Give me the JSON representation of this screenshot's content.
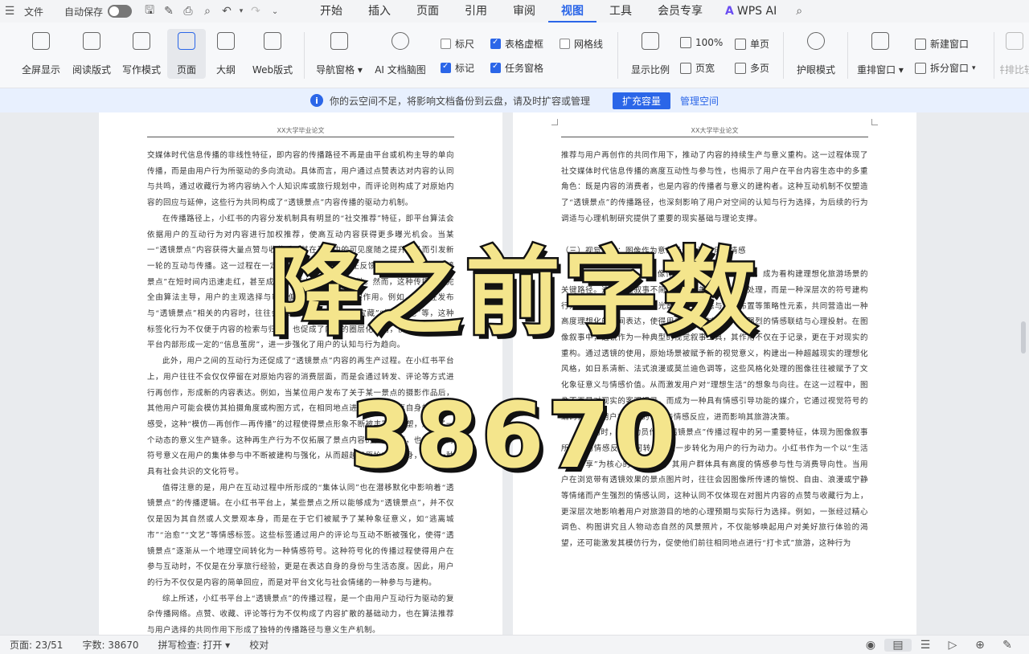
{
  "menubar": {
    "file_label": "文件",
    "autosave_label": "自动保存",
    "tabs": [
      "开始",
      "插入",
      "页面",
      "引用",
      "审阅",
      "视图",
      "工具",
      "会员专享"
    ],
    "active_tab": "视图",
    "wps_ai_label": "WPS AI"
  },
  "ribbon": {
    "fullscreen": "全屏显示",
    "reading_mode": "阅读版式",
    "writing_mode": "写作模式",
    "page": "页面",
    "outline": "大纲",
    "web_layout": "Web版式",
    "nav_pane": "导航窗格",
    "ai_mindmap": "AI 文档脑图",
    "ruler": "标尺",
    "table_gridlines": "表格虚框",
    "gridlines": "网格线",
    "marks": "标记",
    "task_pane": "任务窗格",
    "zoom_ratio": "显示比例",
    "zoom_100": "100%",
    "page_width": "页宽",
    "single_page": "单页",
    "multi_page": "多页",
    "eye_protection": "护眼模式",
    "rearrange_windows": "重排窗口",
    "new_window": "新建窗口",
    "split_window": "拆分窗口",
    "side_by_side": "并排比较"
  },
  "notice": {
    "text": "你的云空间不足，将影响文档备份到云盘，请及时扩容或管理",
    "expand_button": "扩充容量",
    "manage_link": "管理空间"
  },
  "document": {
    "header": "XX大学毕业论文",
    "left_paragraphs": [
      "交媒体时代信息传播的非线性特征，即内容的传播路径不再是由平台或机构主导的单向传播，而是由用户行为所驱动的多向流动。具体而言，用户通过点赞表达对内容的认同与共鸣，通过收藏行为将内容纳入个人知识库或旅行规划中，而评论则构成了对原始内容的回应与延伸，这些行为共同构成了“透镜景点”内容传播的驱动力机制。",
      "在传播路径上，小红书的内容分发机制具有明显的“社交推荐”特征，即平台算法会依据用户的互动行为对内容进行加权推荐，使高互动内容获得更多曝光机会。当某一“透镜景点”内容获得大量点赞与收藏后，其在平台中的可见度随之提升，从而引发新一轮的互动与传播。这一过程在一定程度上形成了传播的正反馈循环，使得部分“透镜景点”在短时间内迅速走红，甚至成为“必打卡”的旅游目的地。然而，这种传播并非完全由算法主导，用户的主观选择与审美偏好同样发挥着重要作用。例如，用户在发布与“透镜景点”相关的内容时，往往会有意识地添加“小众”“宝藏”“拍照圣地”等，这种标签化行为不仅便于内容的检索与归类，也促成了内容的圈层化传播，使得相关话题在平台内部形成一定的“信息茧房”，进一步强化了用户的认知与行为趋向。",
      "此外，用户之间的互动行为还促成了“透镜景点”内容的再生产过程。在小红书平台上，用户往往不会仅仅停留在对原始内容的消费层面，而是会通过转发、评论等方式进行再创作，形成新的内容表达。例如，当某位用户发布了关于某一景点的摄影作品后，其他用户可能会模仿其拍摄角度或构图方式，在相同地点进行拍摄并分享自身的体验与感受，这种“模仿—再创作—再传播”的过程使得景点形象不断被丰富与重塑，形成了一个动态的意义生产链条。这种再生产行为不仅拓展了景点内容的表现维度，也使景点的符号意义在用户的集体参与中不断被建构与强化，从而超越了原始内容本身，成为一种具有社会共识的文化符号。",
      "值得注意的是，用户在互动过程中所形成的“集体认同”也在潜移默化中影响着“透镜景点”的传播逻辑。在小红书平台上，某些景点之所以能够成为“透镜景点”，并不仅仅是因为其自然或人文景观本身，而是在于它们被赋予了某种象征意义，如“逃离城市”“治愈”“文艺”等情感标签。这些标签通过用户的评论与互动不断被强化，使得“透镜景点”逐渐从一个地理空间转化为一种情感符号。这种符号化的传播过程使得用户在参与互动时，不仅是在分享旅行经验，更是在表达自身的身份与生活态度。因此，用户的行为不仅仅是内容的简单回应，而是对平台文化与社会情绪的一种参与与建构。",
      "综上所述，小红书平台上“透镜景点”的传播过程，是一个由用户互动行为驱动的复杂传播网络。点赞、收藏、评论等行为不仅构成了内容扩散的基础动力，也在算法推荐与用户选择的共同作用下形成了独特的传播路径与意义生产机制。"
    ],
    "right_paragraphs_top": [
      "推荐与用户再创作的共同作用下，推动了内容的持续生产与意义重构。这一过程体现了社交媒体时代信息传播的高度互动性与参与性，也揭示了用户在平台内容生态中的多重角色：既是内容的消费者，也是内容的传播者与意义的建构者。这种互动机制不仅塑造了“透镜景点”的传播路径，也深刻影响了用户对空间的认知与行为选择，为后续的行为调适与心理机制研究提供了重要的现实基础与理论支撑。"
    ],
    "right_heading": "（三）视觉呈现：图像作为意象场景并激发用户情感",
    "right_paragraphs_bottom": [
      "在小红书平台上，以图像作为核心的视觉表达手段，成为看构建理想化旅游场景的关键路径。这种视觉叙事不简单的图像美化或技术性处理，而是一种深层次的符号建构行为。它通过色彩、构图、光影、人物动态与场景布置等策略性元素，共同营造出一种高度理想化的空间表达，使得用户在观看过程中产生强烈的情感联结与心理投射。在图像叙事中，透镜作为一种典型的视觉叙事工具，其作用不仅在于记录，更在于对现实的重构。通过透镜的使用，原始场景被赋予新的视觉意义，构建出一种超越现实的理想化风格，如日系清新、法式浪漫或莫兰迪色调等，这些风格化处理的图像往往被赋予了文化象征意义与情感价值。从而激发用户对“理想生活”的想象与向往。在这一过程中，图像不再是对现实的客观记录，而成为一种具有情感引导功能的媒介，它通过视觉符号的编码，引导用户对景点的认知与情感反应，进而影响其旅游决策。",
      "与此同时，情感动员作为“透镜景点”传播过程中的另一重要特征，体现为图像叙事所激发的情感反应如何转化为进一步转化为用户的行为动力。小红书作为一个以“生活方式分享”为核心的社交平台，其用户群体具有高度的情感参与性与消费导向性。当用户在浏览带有透镜效果的景点图片时，往往会因图像所传递的愉悦、自由、浪漫或宁静等情绪而产生强烈的情感认同，这种认同不仅体现在对图片内容的点赞与收藏行为上，更深层次地影响着用户对旅游目的地的心理预期与实际行为选择。例如，一张经过精心调色、构图讲究且人物动态自然的风景照片，不仅能够唤起用户对美好旅行体验的渴望，还可能激发其模仿行为，促使他们前往相同地点进行“打卡式”旅游，这种行为"
    ]
  },
  "overlay": {
    "title": "降之前字数",
    "number": "38670"
  },
  "statusbar": {
    "page": "页面: 23/51",
    "word_count": "字数: 38670",
    "spell_check": "拼写检查: 打开",
    "proofread": "校对"
  }
}
